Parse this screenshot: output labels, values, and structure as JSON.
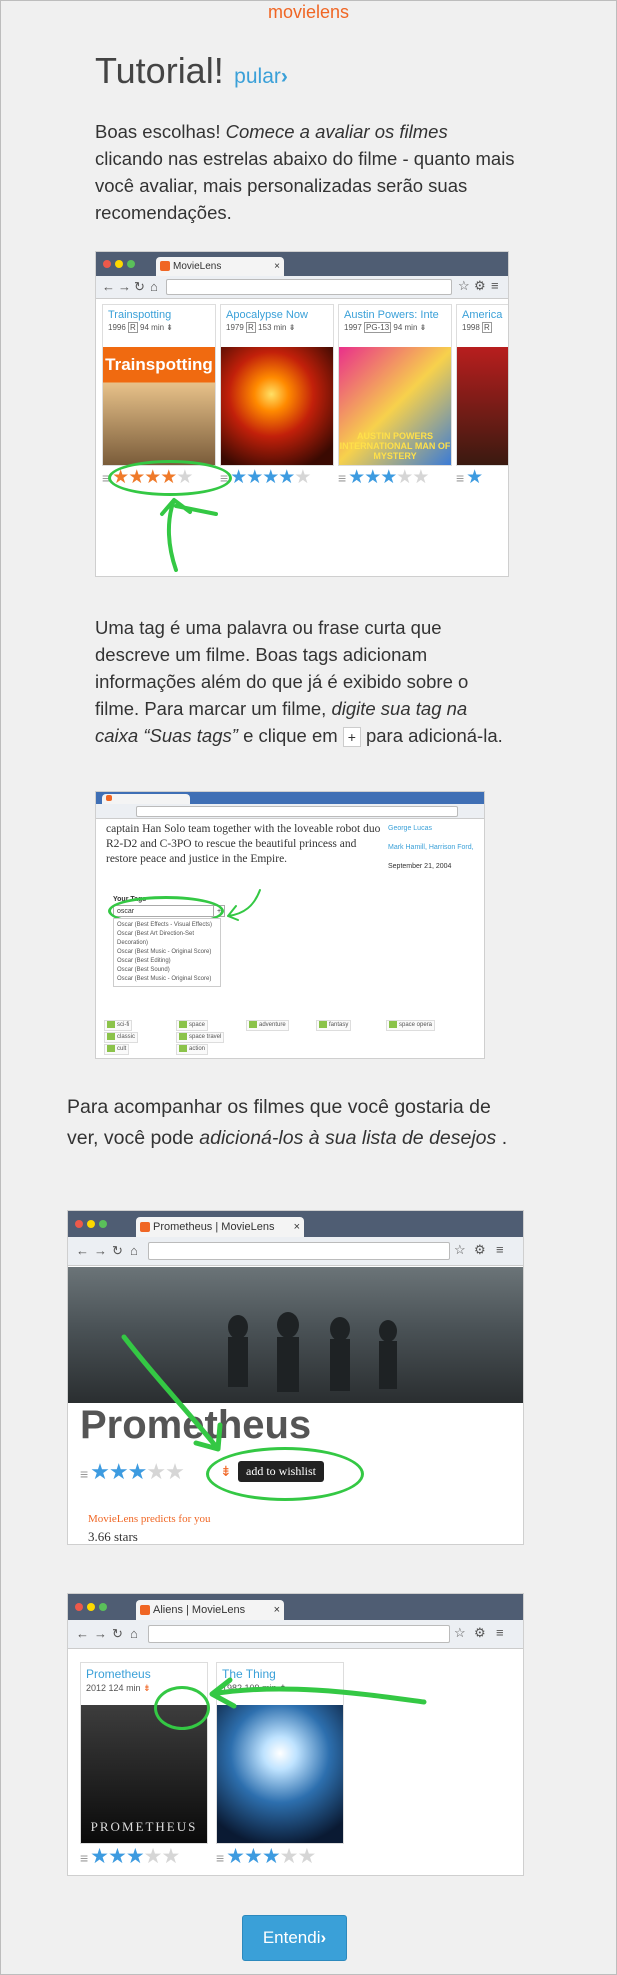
{
  "brand": "movielens",
  "header": {
    "title": "Tutorial!",
    "skip_label": "pular"
  },
  "section1": {
    "text_plain1": "Boas escolhas! ",
    "text_italic1": "Comece a avaliar os filmes",
    "text_plain2": " clicando nas estrelas abaixo do filme - quanto mais você avaliar, mais personalizadas serão suas recomendações.",
    "screenshot": {
      "tab_label": "MovieLens",
      "movies": [
        {
          "title": "Trainspotting",
          "year": "1996",
          "rating_badge": "R",
          "runtime": "94 min",
          "poster_text": "Trainspotting",
          "rating": 4,
          "max": 5
        },
        {
          "title": "Apocalypse Now",
          "year": "1979",
          "rating_badge": "R",
          "runtime": "153 min",
          "poster_text": "",
          "rating": 4,
          "max": 5
        },
        {
          "title": "Austin Powers: Inte",
          "year": "1997",
          "rating_badge": "PG-13",
          "runtime": "94 min",
          "poster_text": "AUSTIN POWERS INTERNATIONAL MAN OF MYSTERY",
          "rating": 3.5,
          "max": 5
        },
        {
          "title": "America",
          "year": "1998",
          "rating_badge": "R",
          "runtime": "",
          "poster_text": "",
          "rating": 1,
          "max": 5
        }
      ]
    }
  },
  "section2": {
    "text_plain1": "Uma tag é uma palavra ou frase curta que descreve um filme. Boas tags adicionam informações além do que já é exibido sobre o filme. Para marcar um filme, ",
    "text_italic1": "digite sua tag na caixa “Suas tags”",
    "text_plain2": " e clique em ",
    "plus_glyph": "+",
    "text_plain3": " para adicioná-la.",
    "screenshot": {
      "body_text": "captain Han Solo team together with the loveable robot duo R2-D2 and C-3PO to rescue the beautiful princess and restore peace and justice in the Empire.",
      "sidebar": [
        "George Lucas",
        "Mark Hamill, Harrison Ford,",
        "September 21, 2004"
      ],
      "your_tags_label": "Your Tags",
      "tag_input_value": "oscar",
      "suggestions": [
        "Oscar (Best Effects - Visual Effects)",
        "Oscar (Best Art Direction-Set Decoration)",
        "Oscar (Best Music - Original Score)",
        "Oscar (Best Editing)",
        "Oscar (Best Sound)",
        "Oscar (Best Music - Original Score)"
      ],
      "tags": [
        "sci-fi",
        "classic",
        "cult",
        "space",
        "space travel",
        "action",
        "adventure",
        "fantasy",
        "space opera"
      ]
    }
  },
  "section3": {
    "text_plain1": "Para acompanhar os filmes que você gostaria de ver, você pode ",
    "text_italic1": "adicioná-los à sua lista de desejos",
    "text_plain2": " .",
    "screenshot": {
      "tab_label": "Prometheus | MovieLens",
      "movie_title": "Prometheus",
      "wishlist_tooltip": "add to wishlist",
      "predict_label": "MovieLens predicts for you",
      "predict_value": "3.66 stars",
      "rating": 3.5
    }
  },
  "section4": {
    "screenshot": {
      "tab_label": "Aliens | MovieLens",
      "movies": [
        {
          "title": "Prometheus",
          "year": "2012",
          "runtime": "124 min",
          "poster_text": "PROMETHEUS",
          "rating": 3.5
        },
        {
          "title": "The Thing",
          "year": "1982",
          "runtime": "109 min",
          "poster_text": "",
          "rating": 3.5
        }
      ]
    }
  },
  "footer": {
    "ok_label": "Entendi"
  },
  "colors": {
    "accent": "#3aa0d8",
    "brand": "#f06624",
    "highlight": "#34c844"
  }
}
